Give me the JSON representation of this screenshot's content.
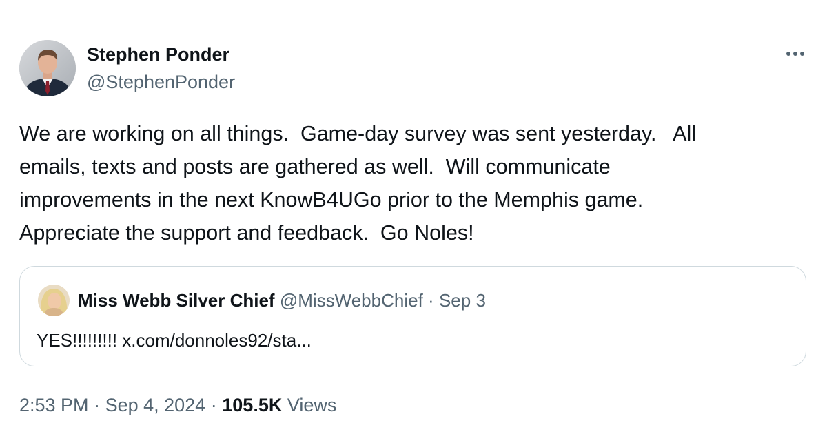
{
  "author": {
    "name": "Stephen Ponder",
    "handle": "@StephenPonder",
    "avatar_icon": "person-photo-icon"
  },
  "menu": {
    "icon": "more-options-icon"
  },
  "tweet": {
    "text": "We are working on all things.  Game-day survey was sent yesterday.   All\nemails, texts and posts are gathered as well.  Will communicate\nimprovements in the next KnowB4UGo prior to the Memphis game.\nAppreciate the support and feedback.  Go Noles!"
  },
  "quote": {
    "name": "Miss Webb Silver Chief",
    "handle": "@MissWebbChief",
    "separator": "·",
    "date": "Sep 3",
    "text": "YES!!!!!!!!! x.com/donnoles92/sta..."
  },
  "meta": {
    "time": "2:53 PM",
    "separator": "·",
    "date": "Sep 4, 2024",
    "views_count": "105.5K",
    "views_label": "Views"
  },
  "colors": {
    "text": "#0f1419",
    "secondary": "#536471",
    "border": "#cfd9de"
  }
}
